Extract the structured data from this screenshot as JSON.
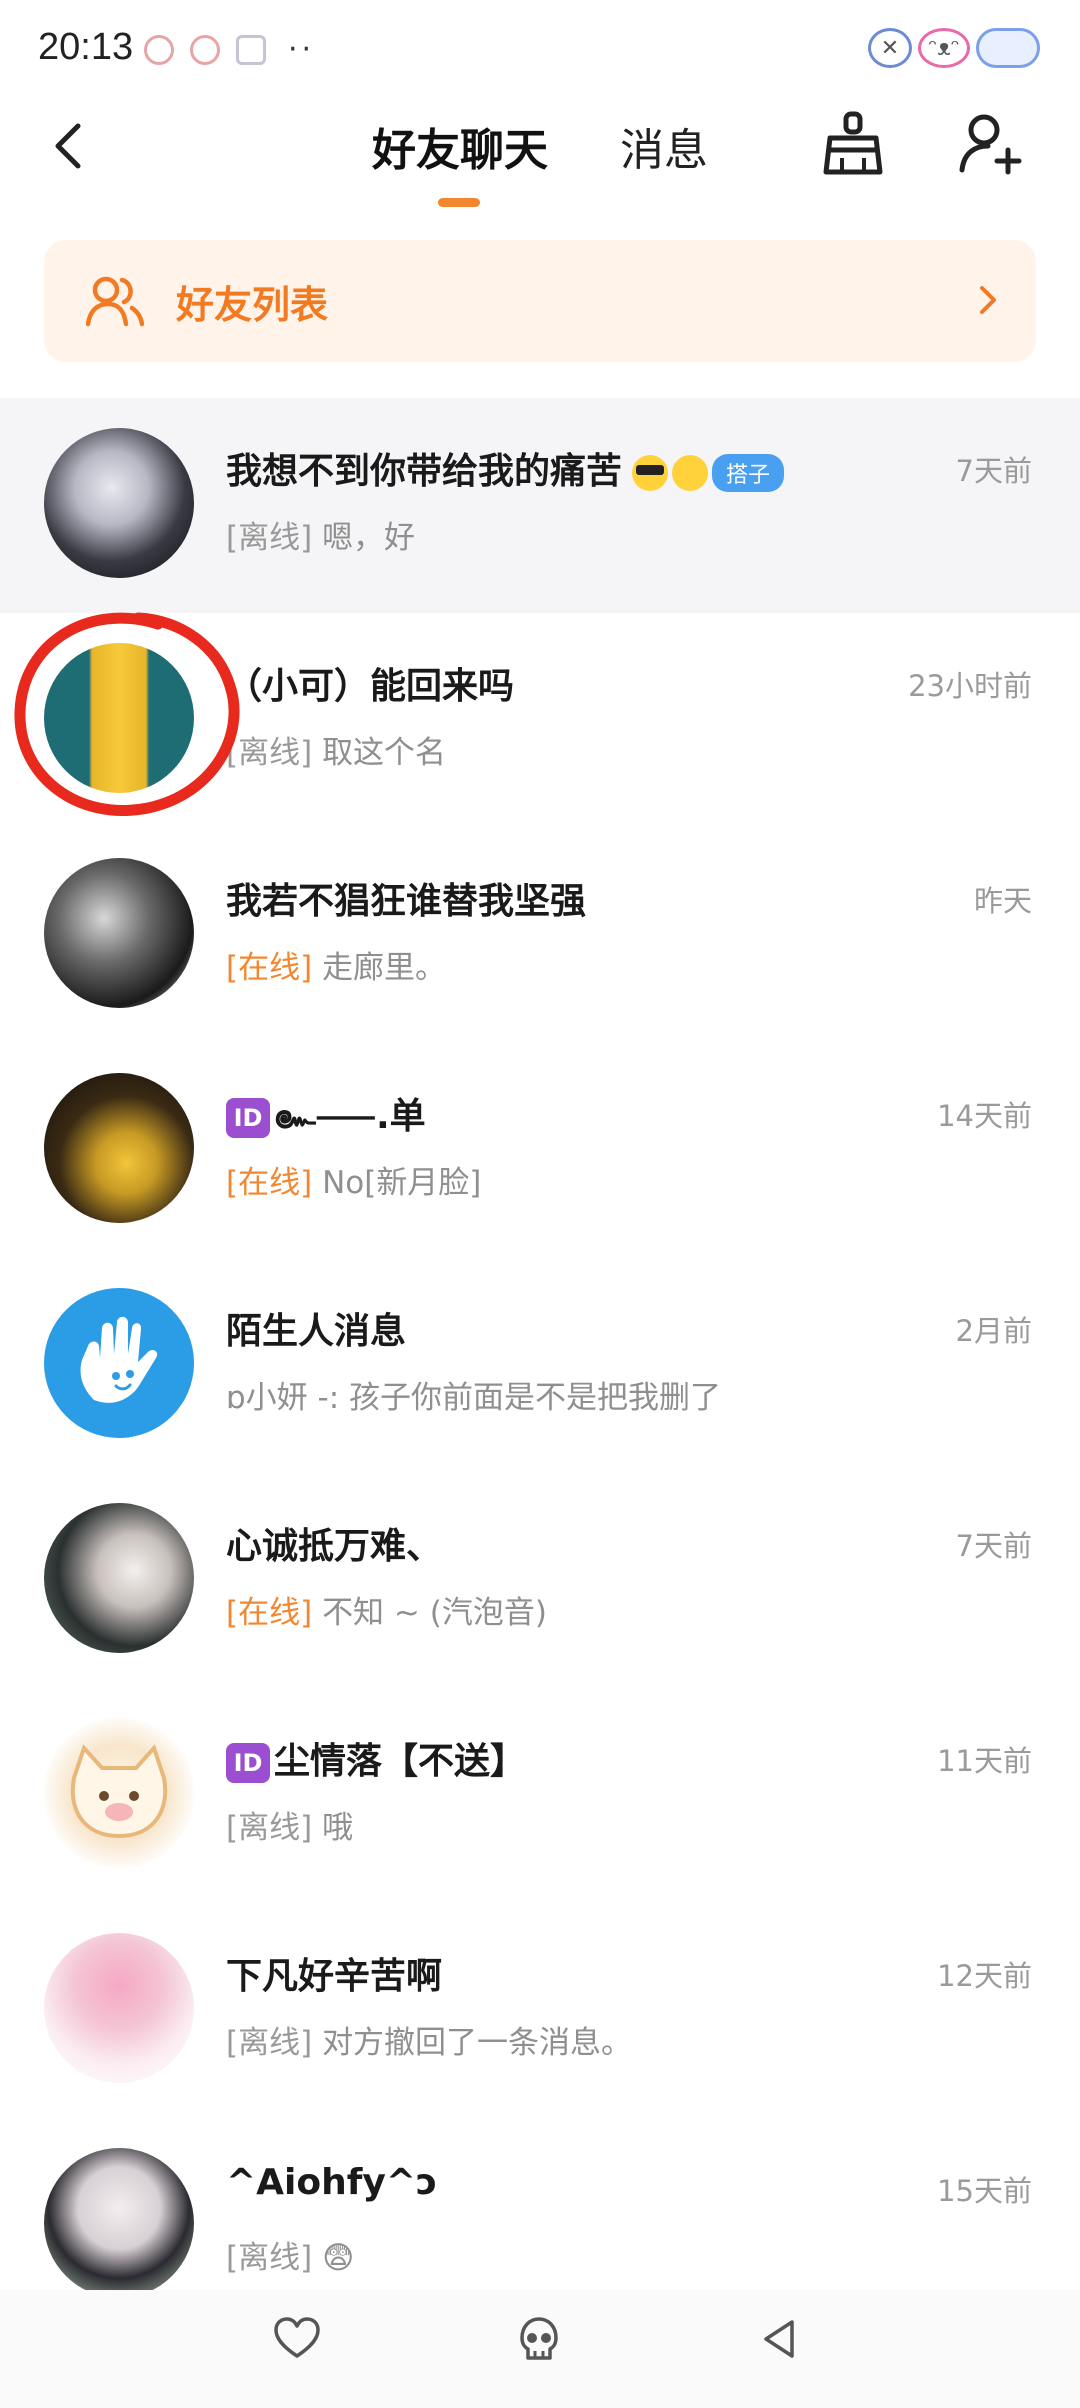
{
  "status_bar": {
    "time": "20:13",
    "dots": "··"
  },
  "header": {
    "tab_friends": "好友聊天",
    "tab_messages": "消息",
    "accent_color": "#f3872f"
  },
  "friends_banner": {
    "label": "好友列表"
  },
  "chats": [
    {
      "name": "我想不到你带给我的痛苦",
      "badge": "搭子",
      "status": "[离线]",
      "online": false,
      "preview": "嗯，好",
      "time": "7天前"
    },
    {
      "name": "（小可）能回来吗",
      "status": "[离线]",
      "online": false,
      "preview": "取这个名",
      "time": "23小时前"
    },
    {
      "name": "我若不猖狂谁替我坚强",
      "status": "[在线]",
      "online": true,
      "preview": "走廊里。",
      "time": "昨天"
    },
    {
      "id_badge": "ID",
      "name": "๛⸺.单",
      "status": "[在线]",
      "online": true,
      "preview": "No[新月脸]",
      "time": "14天前"
    },
    {
      "name": "陌生人消息",
      "preview": "ɒ小妍 -: 孩子你前面是不是把我删了",
      "time": "2月前"
    },
    {
      "name": "心诚抵万难、",
      "status": "[在线]",
      "online": true,
      "preview": "不知 ~ (汽泡音)",
      "time": "7天前"
    },
    {
      "id_badge": "ID",
      "name": "尘情落【不送】",
      "status": "[离线]",
      "online": false,
      "preview": "哦",
      "time": "11天前"
    },
    {
      "name": "下凡好辛苦啊",
      "status": "[离线]",
      "online": false,
      "preview": "对方撤回了一条消息。",
      "time": "12天前"
    },
    {
      "name": "^Aiohfy^ɔ",
      "status": "[离线]",
      "online": false,
      "preview": "😨",
      "time": "15天前"
    }
  ]
}
